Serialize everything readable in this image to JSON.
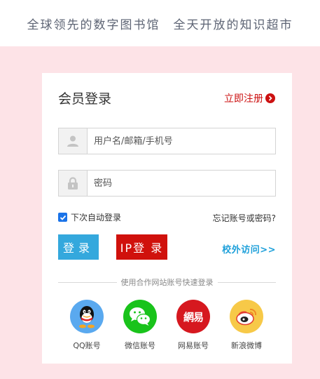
{
  "header": {
    "slogan": "全球领先的数字图书馆　全天开放的知识超市"
  },
  "login": {
    "title": "会员登录",
    "register_label": "立即注册",
    "username": {
      "placeholder": "用户名/邮箱/手机号",
      "value": ""
    },
    "password": {
      "placeholder": "密码",
      "value": ""
    },
    "remember_label": "下次自动登录",
    "remember_checked": true,
    "forgot_label": "忘记账号或密码?",
    "login_button": "登录",
    "ip_login_button": "IP登 录",
    "offcampus_label": "校外访问>>"
  },
  "social": {
    "divider_text": "使用合作网站账号快速登录",
    "items": [
      {
        "label": "QQ账号",
        "icon": "qq-icon",
        "color": "#5aa9ef"
      },
      {
        "label": "微信账号",
        "icon": "wechat-icon",
        "color": "#19c31b"
      },
      {
        "label": "网易账号",
        "icon": "netease-icon",
        "color": "#d6181f",
        "glyph": "網易"
      },
      {
        "label": "新浪微博",
        "icon": "weibo-icon",
        "color": "#f7c948"
      }
    ]
  },
  "colors": {
    "backdrop": "#fde3e7",
    "accent_red": "#cc1111",
    "login_blue": "#34a8dd",
    "link_blue": "#1ea0da"
  }
}
